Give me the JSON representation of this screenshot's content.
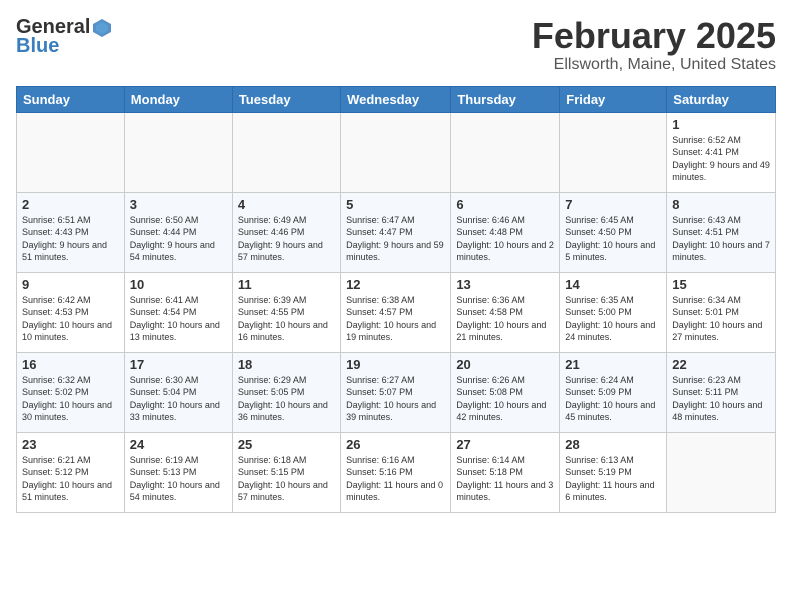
{
  "logo": {
    "general": "General",
    "blue": "Blue"
  },
  "title": "February 2025",
  "subtitle": "Ellsworth, Maine, United States",
  "days_of_week": [
    "Sunday",
    "Monday",
    "Tuesday",
    "Wednesday",
    "Thursday",
    "Friday",
    "Saturday"
  ],
  "weeks": [
    [
      {
        "day": "",
        "info": ""
      },
      {
        "day": "",
        "info": ""
      },
      {
        "day": "",
        "info": ""
      },
      {
        "day": "",
        "info": ""
      },
      {
        "day": "",
        "info": ""
      },
      {
        "day": "",
        "info": ""
      },
      {
        "day": "1",
        "info": "Sunrise: 6:52 AM\nSunset: 4:41 PM\nDaylight: 9 hours and 49 minutes."
      }
    ],
    [
      {
        "day": "2",
        "info": "Sunrise: 6:51 AM\nSunset: 4:43 PM\nDaylight: 9 hours and 51 minutes."
      },
      {
        "day": "3",
        "info": "Sunrise: 6:50 AM\nSunset: 4:44 PM\nDaylight: 9 hours and 54 minutes."
      },
      {
        "day": "4",
        "info": "Sunrise: 6:49 AM\nSunset: 4:46 PM\nDaylight: 9 hours and 57 minutes."
      },
      {
        "day": "5",
        "info": "Sunrise: 6:47 AM\nSunset: 4:47 PM\nDaylight: 9 hours and 59 minutes."
      },
      {
        "day": "6",
        "info": "Sunrise: 6:46 AM\nSunset: 4:48 PM\nDaylight: 10 hours and 2 minutes."
      },
      {
        "day": "7",
        "info": "Sunrise: 6:45 AM\nSunset: 4:50 PM\nDaylight: 10 hours and 5 minutes."
      },
      {
        "day": "8",
        "info": "Sunrise: 6:43 AM\nSunset: 4:51 PM\nDaylight: 10 hours and 7 minutes."
      }
    ],
    [
      {
        "day": "9",
        "info": "Sunrise: 6:42 AM\nSunset: 4:53 PM\nDaylight: 10 hours and 10 minutes."
      },
      {
        "day": "10",
        "info": "Sunrise: 6:41 AM\nSunset: 4:54 PM\nDaylight: 10 hours and 13 minutes."
      },
      {
        "day": "11",
        "info": "Sunrise: 6:39 AM\nSunset: 4:55 PM\nDaylight: 10 hours and 16 minutes."
      },
      {
        "day": "12",
        "info": "Sunrise: 6:38 AM\nSunset: 4:57 PM\nDaylight: 10 hours and 19 minutes."
      },
      {
        "day": "13",
        "info": "Sunrise: 6:36 AM\nSunset: 4:58 PM\nDaylight: 10 hours and 21 minutes."
      },
      {
        "day": "14",
        "info": "Sunrise: 6:35 AM\nSunset: 5:00 PM\nDaylight: 10 hours and 24 minutes."
      },
      {
        "day": "15",
        "info": "Sunrise: 6:34 AM\nSunset: 5:01 PM\nDaylight: 10 hours and 27 minutes."
      }
    ],
    [
      {
        "day": "16",
        "info": "Sunrise: 6:32 AM\nSunset: 5:02 PM\nDaylight: 10 hours and 30 minutes."
      },
      {
        "day": "17",
        "info": "Sunrise: 6:30 AM\nSunset: 5:04 PM\nDaylight: 10 hours and 33 minutes."
      },
      {
        "day": "18",
        "info": "Sunrise: 6:29 AM\nSunset: 5:05 PM\nDaylight: 10 hours and 36 minutes."
      },
      {
        "day": "19",
        "info": "Sunrise: 6:27 AM\nSunset: 5:07 PM\nDaylight: 10 hours and 39 minutes."
      },
      {
        "day": "20",
        "info": "Sunrise: 6:26 AM\nSunset: 5:08 PM\nDaylight: 10 hours and 42 minutes."
      },
      {
        "day": "21",
        "info": "Sunrise: 6:24 AM\nSunset: 5:09 PM\nDaylight: 10 hours and 45 minutes."
      },
      {
        "day": "22",
        "info": "Sunrise: 6:23 AM\nSunset: 5:11 PM\nDaylight: 10 hours and 48 minutes."
      }
    ],
    [
      {
        "day": "23",
        "info": "Sunrise: 6:21 AM\nSunset: 5:12 PM\nDaylight: 10 hours and 51 minutes."
      },
      {
        "day": "24",
        "info": "Sunrise: 6:19 AM\nSunset: 5:13 PM\nDaylight: 10 hours and 54 minutes."
      },
      {
        "day": "25",
        "info": "Sunrise: 6:18 AM\nSunset: 5:15 PM\nDaylight: 10 hours and 57 minutes."
      },
      {
        "day": "26",
        "info": "Sunrise: 6:16 AM\nSunset: 5:16 PM\nDaylight: 11 hours and 0 minutes."
      },
      {
        "day": "27",
        "info": "Sunrise: 6:14 AM\nSunset: 5:18 PM\nDaylight: 11 hours and 3 minutes."
      },
      {
        "day": "28",
        "info": "Sunrise: 6:13 AM\nSunset: 5:19 PM\nDaylight: 11 hours and 6 minutes."
      },
      {
        "day": "",
        "info": ""
      }
    ]
  ]
}
